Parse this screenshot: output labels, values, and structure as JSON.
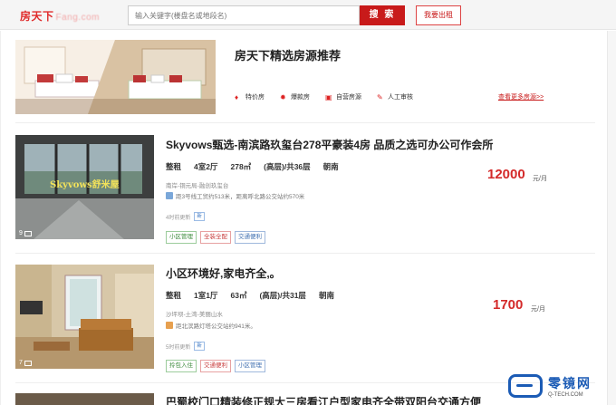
{
  "header": {
    "logo_text": "房天下",
    "logo_domain": "Fang.com",
    "search_placeholder": "输入关键字(楼盘名或地段名)",
    "search_button": "搜 索",
    "rent_button": "我要出租"
  },
  "promo": {
    "title": "房天下精选房源推荐",
    "tags": [
      {
        "icon": "tag-icon",
        "label": "特价房"
      },
      {
        "icon": "fire-icon",
        "label": "爆款房"
      },
      {
        "icon": "shop-icon",
        "label": "自营房源"
      },
      {
        "icon": "inspect-icon",
        "label": "人工审核"
      }
    ],
    "more_link": "查看更多房源>>"
  },
  "listings": [
    {
      "title": "Skyvows甄选-南滨路玖玺台278平豪装4房 品质之选可办公可作会所",
      "image_caption": "Skyvows舒米屋",
      "image_count": "9",
      "attrs": [
        "整租",
        "4室2厅",
        "278㎡",
        "(高层)/共36层",
        "朝南"
      ],
      "address": "南岸-铜元局-融创玖玺台",
      "traffic": "距3号线工贸约513米，距离呼北路公交站约570米",
      "update": "4时前更新",
      "badge": "新",
      "tags": [
        {
          "label": "小区管理",
          "color": "green"
        },
        {
          "label": "全装全配",
          "color": "red"
        },
        {
          "label": "交通便利",
          "color": "blue"
        }
      ],
      "price": "12000",
      "unit": "元/月"
    },
    {
      "title": "小区环境好,家电齐全,。",
      "image_caption": "",
      "image_count": "7",
      "attrs": [
        "整租",
        "1室1厅",
        "63㎡",
        "(高层)/共31层",
        "朝南"
      ],
      "address": "沙坪坝-土湾-美丽山水",
      "traffic": "距北滨路灯塔公交站约941米。",
      "update": "5时前更新",
      "badge": "新",
      "tags": [
        {
          "label": "拎包入住",
          "color": "green"
        },
        {
          "label": "交通便利",
          "color": "red"
        },
        {
          "label": "小区管理",
          "color": "blue"
        }
      ],
      "price": "1700",
      "unit": "元/月"
    },
    {
      "title": "巴蜀校门口精装修正规大三房看江户型家电齐全带双阳台交通方便"
    }
  ],
  "watermark": {
    "brand": "零镜网",
    "domain": "Q-TECH.COM"
  },
  "colors": {
    "accent": "#c81a1a",
    "price": "#d42a2a",
    "link": "#1b5bb5"
  }
}
